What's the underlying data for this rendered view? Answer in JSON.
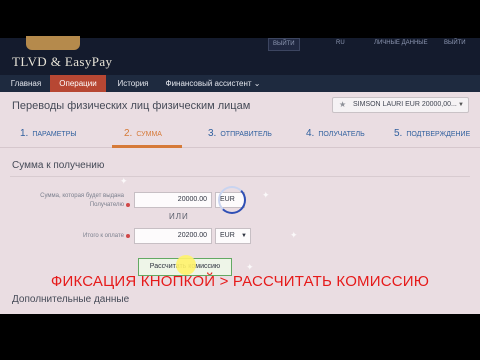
{
  "app": {
    "logo_text": "TLVD & EasyPay"
  },
  "topbar": {
    "buttons": [
      "ВЫЙТИ",
      "RU",
      "ЛИЧНЫЕ ДАННЫЕ",
      "ВЫЙТИ"
    ]
  },
  "nav": {
    "items": [
      "Главная",
      "Операции",
      "История",
      "Финансовый ассистент ⌄"
    ],
    "active_index": 1
  },
  "page": {
    "title": "Переводы физических лиц физическим лицам",
    "sender_select": "SIMSON LAURI EUR 20000,00..."
  },
  "steps": [
    {
      "num": "1.",
      "label": "ПАРАМЕТРЫ"
    },
    {
      "num": "2.",
      "label": "СУММА"
    },
    {
      "num": "3.",
      "label": "ОТПРАВИТЕЛЬ"
    },
    {
      "num": "4.",
      "label": "ПОЛУЧАТЕЛЬ"
    },
    {
      "num": "5.",
      "label": "ПОДТВЕРЖДЕНИЕ"
    }
  ],
  "current_step": 2,
  "form": {
    "section_title": "Сумма к получению",
    "receive_label_1": "Сумма, которая будет выдана",
    "receive_label_2": "Получателю",
    "receive_amount": "20000.00",
    "receive_currency": "EUR",
    "or_text": "ИЛИ",
    "pay_label": "Итого к оплате",
    "pay_amount": "20200.00",
    "pay_currency": "EUR",
    "calc_button": "Рассчитать комиссию",
    "extra_title": "Дополнительные данные"
  },
  "caption": "ФИКСАЦИЯ КНОПКОЙ > РАССЧИТАТЬ КОМИССИЮ",
  "colors": {
    "nav_active": "#b74733",
    "step_link": "#2f5f9e",
    "step_current": "#d67a38",
    "caption_red": "#e61a1a",
    "page_bg": "#eadde2"
  }
}
